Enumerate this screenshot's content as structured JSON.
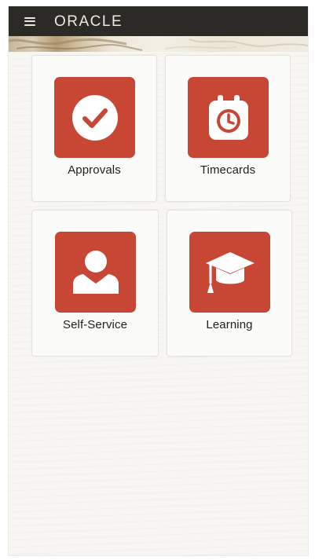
{
  "header": {
    "menu_icon": "hamburger-menu-icon",
    "logo_text": "ORACLE"
  },
  "tiles": [
    {
      "label": "Approvals",
      "icon": "check-circle-icon"
    },
    {
      "label": "Timecards",
      "icon": "clock-calendar-icon"
    },
    {
      "label": "Self-Service",
      "icon": "person-icon"
    },
    {
      "label": "Learning",
      "icon": "graduation-cap-icon"
    }
  ],
  "colors": {
    "header_bg": "#2b2a27",
    "tile_icon_bg": "#c74634",
    "page_bg": "#f6f5f2"
  }
}
